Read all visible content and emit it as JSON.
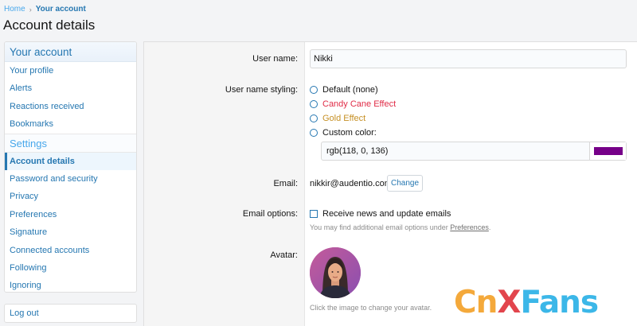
{
  "breadcrumb": {
    "home": "Home",
    "current": "Your account"
  },
  "page_title": "Account details",
  "sidebar": {
    "header": "Your account",
    "items": [
      "Your profile",
      "Alerts",
      "Reactions received",
      "Bookmarks"
    ],
    "section": "Settings",
    "settings_items": [
      "Account details",
      "Password and security",
      "Privacy",
      "Preferences",
      "Signature",
      "Connected accounts",
      "Following",
      "Ignoring"
    ],
    "logout": "Log out"
  },
  "form": {
    "username_label": "User name:",
    "username_value": "Nikki",
    "styling_label": "User name styling:",
    "styling_options": [
      "Default (none)",
      "Candy Cane Effect",
      "Gold Effect",
      "Custom color:"
    ],
    "custom_color_value": "rgb(118, 0, 136)",
    "custom_color_hex": "#760088",
    "email_label": "Email:",
    "email_value": "nikkir@audentio.com",
    "change_button": "Change",
    "email_options_label": "Email options:",
    "receive_news": "Receive news and update emails",
    "email_hint_prefix": "You may find additional email options under ",
    "email_hint_link": "Preferences",
    "email_hint_suffix": ".",
    "avatar_label": "Avatar:",
    "avatar_hint": "Click the image to change your avatar."
  },
  "watermark": {
    "c1": "Cn",
    "c2": "X",
    "c3": "Fans"
  },
  "colors": {
    "accent": "#2577b1",
    "link": "#47a7eb",
    "custom": "#760088"
  }
}
